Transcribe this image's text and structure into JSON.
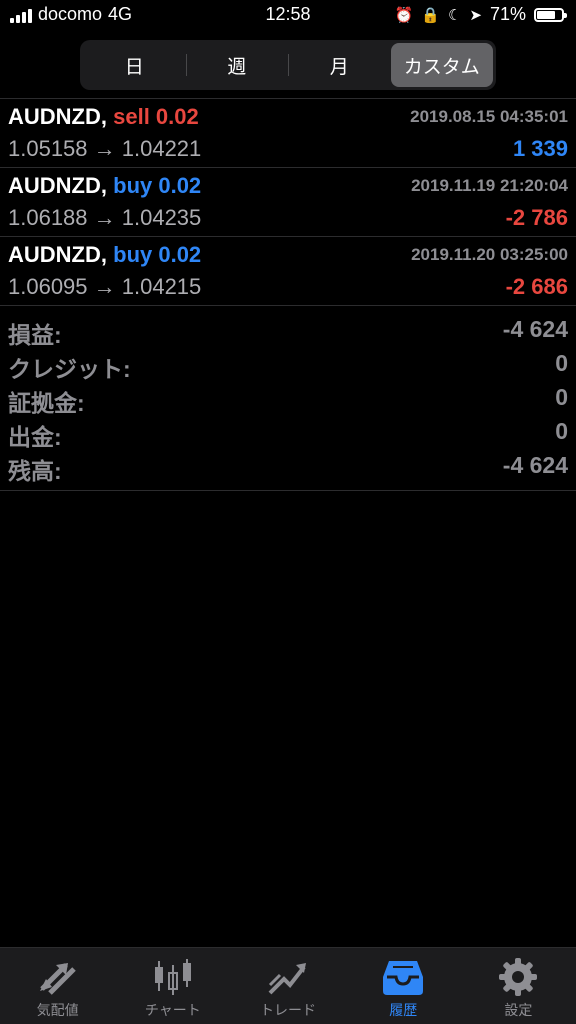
{
  "status_bar": {
    "carrier": "docomo",
    "network": "4G",
    "time": "12:58",
    "battery": "71%"
  },
  "segments": [
    {
      "label": "日",
      "active": false
    },
    {
      "label": "週",
      "active": false
    },
    {
      "label": "月",
      "active": false
    },
    {
      "label": "カスタム",
      "active": true
    }
  ],
  "trades": [
    {
      "symbol": "AUDNZD,",
      "side": "sell 0.02",
      "side_type": "sell",
      "datetime": "2019.08.15 04:35:01",
      "prices": "1.05158 → 1.04221",
      "profit": "1 339",
      "profit_sign": "pos"
    },
    {
      "symbol": "AUDNZD,",
      "side": "buy 0.02",
      "side_type": "buy",
      "datetime": "2019.11.19 21:20:04",
      "prices": "1.06188 → 1.04235",
      "profit": "-2 786",
      "profit_sign": "neg"
    },
    {
      "symbol": "AUDNZD,",
      "side": "buy 0.02",
      "side_type": "buy",
      "datetime": "2019.11.20 03:25:00",
      "prices": "1.06095 → 1.04215",
      "profit": "-2 686",
      "profit_sign": "neg"
    }
  ],
  "summary": [
    {
      "label": "損益:",
      "value": "-4 624"
    },
    {
      "label": "クレジット:",
      "value": "0"
    },
    {
      "label": "証拠金:",
      "value": "0"
    },
    {
      "label": "出金:",
      "value": "0"
    },
    {
      "label": "残高:",
      "value": "-4 624"
    }
  ],
  "tabs": [
    {
      "label": "気配値",
      "icon": "quotes-arrows-icon",
      "active": false
    },
    {
      "label": "チャート",
      "icon": "candlestick-icon",
      "active": false
    },
    {
      "label": "トレード",
      "icon": "trade-chart-icon",
      "active": false
    },
    {
      "label": "履歴",
      "icon": "history-inbox-icon",
      "active": true
    },
    {
      "label": "設定",
      "icon": "gear-icon",
      "active": false
    }
  ],
  "colors": {
    "background": "#000000",
    "sell": "#e8473f",
    "buy": "#2f86f6",
    "profit_positive": "#2f86f6",
    "profit_negative": "#e8473f",
    "muted": "#8e8e93"
  }
}
